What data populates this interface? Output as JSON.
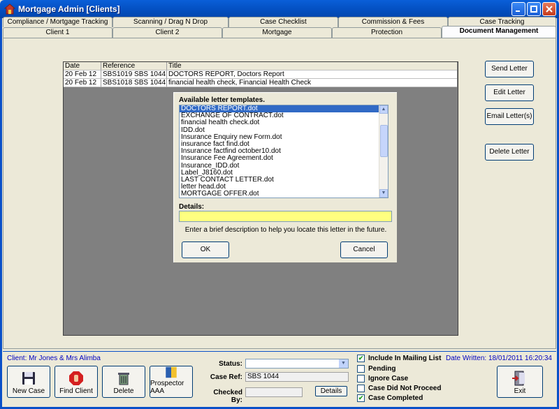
{
  "window": {
    "title": "Mortgage Admin [Clients]"
  },
  "tabs_row1": [
    "Compliance / Mortgage Tracking",
    "Scanning / Drag N Drop",
    "Case Checklist",
    "Commission & Fees",
    "Case Tracking"
  ],
  "tabs_row2": [
    "Client 1",
    "Client 2",
    "Mortgage",
    "Protection",
    "Document Management"
  ],
  "active_tab": "Document Management",
  "letters_grid": {
    "headers": [
      "Date",
      "Reference",
      "Title"
    ],
    "rows": [
      [
        "20 Feb 12",
        "SBS1019 SBS 1044",
        "DOCTORS REPORT, Doctors Report"
      ],
      [
        "20 Feb 12",
        "SBS1018 SBS 1044",
        "financial health check, Financial Health Check"
      ]
    ]
  },
  "right_buttons": {
    "send": "Send Letter",
    "edit": "Edit Letter",
    "email": "Email Letter(s)",
    "delete": "Delete Letter"
  },
  "dialog": {
    "list_label": "Available letter templates.",
    "templates": [
      "DOCTORS REPORT.dot",
      "EXCHANGE OF CONTRACT.dot",
      "financial health check.dot",
      "IDD.dot",
      "Insurance Enquiry new Form.dot",
      "insurance fact find.dot",
      "Insurance factfind october10.dot",
      "Insurance Fee Agreement.dot",
      "Insurance_IDD.dot",
      "Label_J8160.dot",
      "LAST CONTACT LETTER.dot",
      "letter head.dot",
      "MORTGAGE OFFER.dot"
    ],
    "selected_index": 0,
    "details_label": "Details:",
    "details_value": "",
    "hint": "Enter a brief description to help you locate this letter in the future.",
    "ok_label": "OK",
    "cancel_label": "Cancel"
  },
  "footer": {
    "client": "Client: Mr Jones & Mrs Alimba",
    "date_written": "Date Written: 18/01/2011 16:20:34",
    "buttons": {
      "new_case": "New Case",
      "find_client": "Find Client",
      "delete": "Delete",
      "prospector": "Prospector AAA",
      "exit": "Exit"
    },
    "status_label": "Status:",
    "status_value": "",
    "case_ref_label": "Case Ref:",
    "case_ref_value": "SBS 1044",
    "checked_by_label": "Checked By:",
    "checked_by_value": "",
    "details_button": "Details",
    "checkboxes": [
      {
        "label": "Include In Mailing List",
        "checked": true
      },
      {
        "label": "Pending",
        "checked": false
      },
      {
        "label": "Ignore Case",
        "checked": false
      },
      {
        "label": "Case Did Not Proceed",
        "checked": false
      },
      {
        "label": "Case Completed",
        "checked": true
      }
    ]
  },
  "colors": {
    "titlebar": "#0553C7",
    "dialog_selection": "#316AC5",
    "details_bg": "#FFFF80",
    "footer_text": "#0000C0"
  }
}
